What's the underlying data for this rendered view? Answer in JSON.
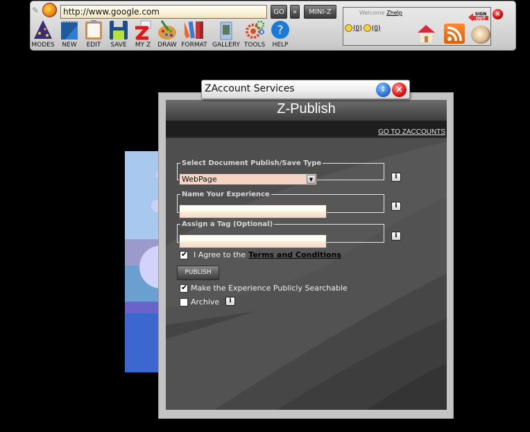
{
  "toolbar": {
    "url": "http://www.google.com",
    "go_label": "GO",
    "more_label": "»",
    "miniz_label": "MINI-Z",
    "tools": [
      {
        "label": "MODES",
        "icon": "wizard-hat-icon"
      },
      {
        "label": "NEW",
        "icon": "notebook-icon"
      },
      {
        "label": "EDIT",
        "icon": "clipboard-icon"
      },
      {
        "label": "SAVE",
        "icon": "floppy-disk-icon"
      },
      {
        "label": "MY Z",
        "icon": "my-z-icon"
      },
      {
        "label": "DRAW",
        "icon": "paint-palette-icon"
      },
      {
        "label": "FORMAT",
        "icon": "color-swatch-icon"
      },
      {
        "label": "GALLERY",
        "icon": "gallery-folder-icon"
      },
      {
        "label": "TOOLS",
        "icon": "gears-icon"
      },
      {
        "label": "HELP",
        "icon": "help-icon"
      }
    ]
  },
  "user_panel": {
    "welcome_prefix": "Welcome",
    "username": "Zhelp",
    "bee_count": "(0)",
    "message_count": "(0)",
    "sign_top": "SIGN",
    "sign_bottom": "OUT"
  },
  "dialog": {
    "window_title": "ZAccount Services",
    "header_title": "Z-Publish",
    "goto_link": "GO TO ZACCOUNTS",
    "publish_type": {
      "legend": "Select Document Publish/Save Type",
      "selected": "WebPage"
    },
    "name_field": {
      "legend": "Name Your Experience",
      "value": ""
    },
    "tag_field": {
      "legend": "Assign a Tag (Optional)",
      "value": ""
    },
    "info_label": "i",
    "agree": {
      "checked": true,
      "prefix": "I Agree to the",
      "link": "Terms and Conditions"
    },
    "publish_button": "PUBLISH",
    "searchable": {
      "checked": true,
      "label": "Make the Experience Publicly Searchable"
    },
    "archive": {
      "checked": false,
      "label": "Archive"
    }
  },
  "colors": {
    "select_bg": "#f5d4c6",
    "dialog_body": "#4d4d4d",
    "frame": "#c4c4c4",
    "close_red": "#e01010",
    "minimize_blue": "#2a72d6"
  }
}
